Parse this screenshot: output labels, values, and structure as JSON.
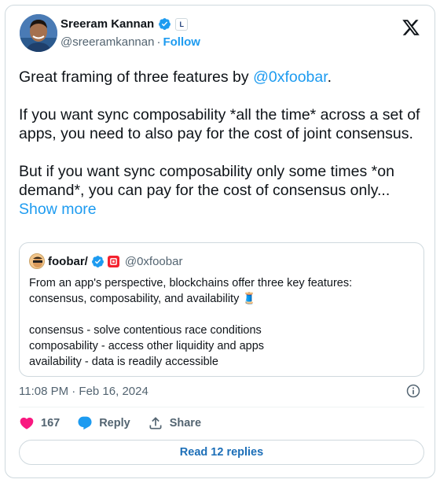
{
  "author": {
    "name": "Sreeram Kannan",
    "handle": "@sreeramkannan",
    "separator": "·",
    "follow_label": "Follow",
    "affiliate_badge": "L"
  },
  "tweet": {
    "intro_text": "Great framing of three features by ",
    "intro_mention": "@0xfoobar",
    "intro_end": ".",
    "paragraph_2": "If you want sync composability *all the time* across a set of apps, you need to also pay for the cost of joint consensus.",
    "paragraph_3": "But if you want sync composability only some times *on demand*, you can pay for the cost of consensus only...",
    "show_more": "Show more"
  },
  "quote": {
    "name": "foobar/",
    "handle": "@0xfoobar",
    "line_1": "From an app's perspective, blockchains offer three key features:",
    "line_2": "consensus, composability, and availability 🧵",
    "line_3": "consensus - solve contentious race conditions",
    "line_4": "composability - access other liquidity and apps",
    "line_5": "availability - data is readily accessible"
  },
  "meta": {
    "timestamp": "11:08 PM · Feb 16, 2024"
  },
  "actions": {
    "like_count": "167",
    "reply_label": "Reply",
    "share_label": "Share",
    "read_replies_label": "Read 12 replies"
  },
  "colors": {
    "accent": "#1d9bf0",
    "like": "#f91880",
    "text": "#0f1419",
    "muted": "#536471",
    "border": "#cfd9de"
  },
  "icons": [
    "x-logo-icon",
    "verified-icon",
    "info-icon",
    "heart-icon",
    "reply-icon",
    "share-icon"
  ]
}
